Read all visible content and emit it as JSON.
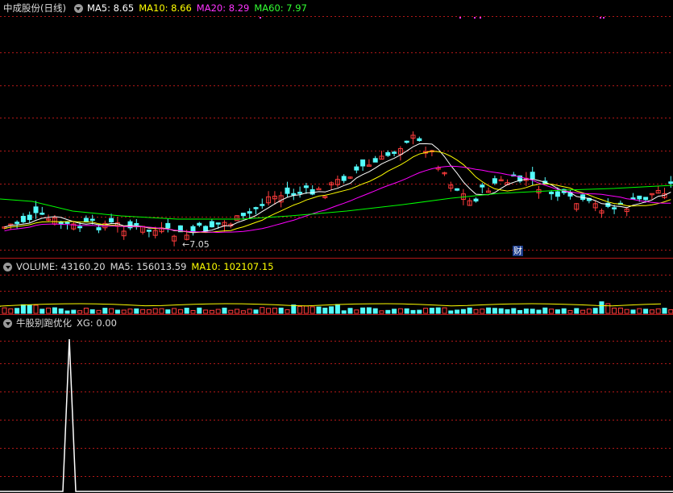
{
  "main": {
    "title": "中成股份(日线)",
    "ma5_label": "MA5: 8.65",
    "ma10_label": "MA10: 8.66",
    "ma20_label": "MA20: 8.29",
    "ma60_label": "MA60: 7.97",
    "low_marker": "7.05",
    "event_marker": "财"
  },
  "volume": {
    "title": "VOLUME: 43160.20",
    "ma5_label": "MA5: 156013.59",
    "ma10_label": "MA10: 102107.15"
  },
  "indicator": {
    "title": "牛股别跑优化",
    "xg_label": "XG: 0.00"
  },
  "colors": {
    "up": "#ff3c3c",
    "down": "#54fcfc",
    "ma5": "#ffffff",
    "ma10": "#ffff00",
    "ma20": "#ff00ff",
    "ma60": "#00ff00",
    "grid": "#b01818",
    "background": "#000000"
  },
  "icons": {
    "collapse": "chevron-down-icon"
  }
}
